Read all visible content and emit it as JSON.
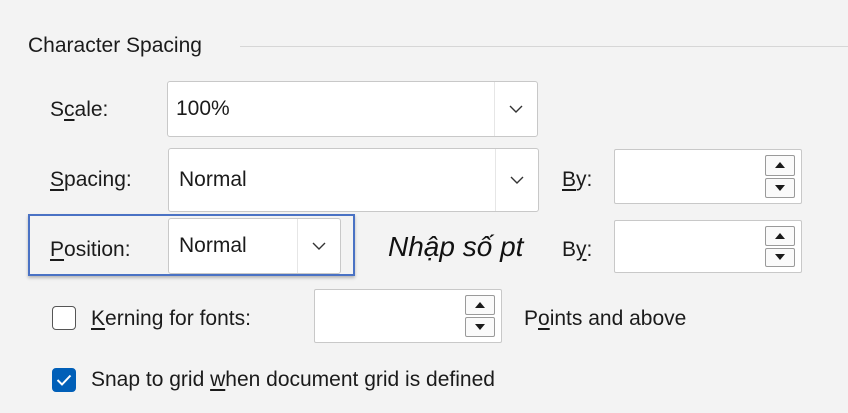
{
  "group": {
    "title": "Character Spacing"
  },
  "scale": {
    "label_pre": "S",
    "label_u": "c",
    "label_post": "ale:",
    "value": "100%"
  },
  "spacing": {
    "label_pre": "",
    "label_u": "S",
    "label_post": "pacing:",
    "value": "Normal",
    "by_pre": "",
    "by_u": "B",
    "by_post": "y:",
    "by_value": ""
  },
  "position": {
    "label_pre": "",
    "label_u": "P",
    "label_post": "osition:",
    "value": "Normal",
    "by_pre": "B",
    "by_u": "y",
    "by_post": ":",
    "by_value": ""
  },
  "annotation": {
    "text": "Nhập số pt"
  },
  "kerning": {
    "checked": false,
    "label_pre": "",
    "label_u": "K",
    "label_post": "erning for fonts:",
    "value": "",
    "suffix_pre": "P",
    "suffix_u": "o",
    "suffix_post": "ints and above"
  },
  "snap": {
    "checked": true,
    "label_pre": "Snap to grid ",
    "label_u": "w",
    "label_post": "hen document grid is defined"
  },
  "colors": {
    "accent": "#005fb8",
    "highlight": "#4a72c4",
    "background": "#f3f3f3"
  }
}
